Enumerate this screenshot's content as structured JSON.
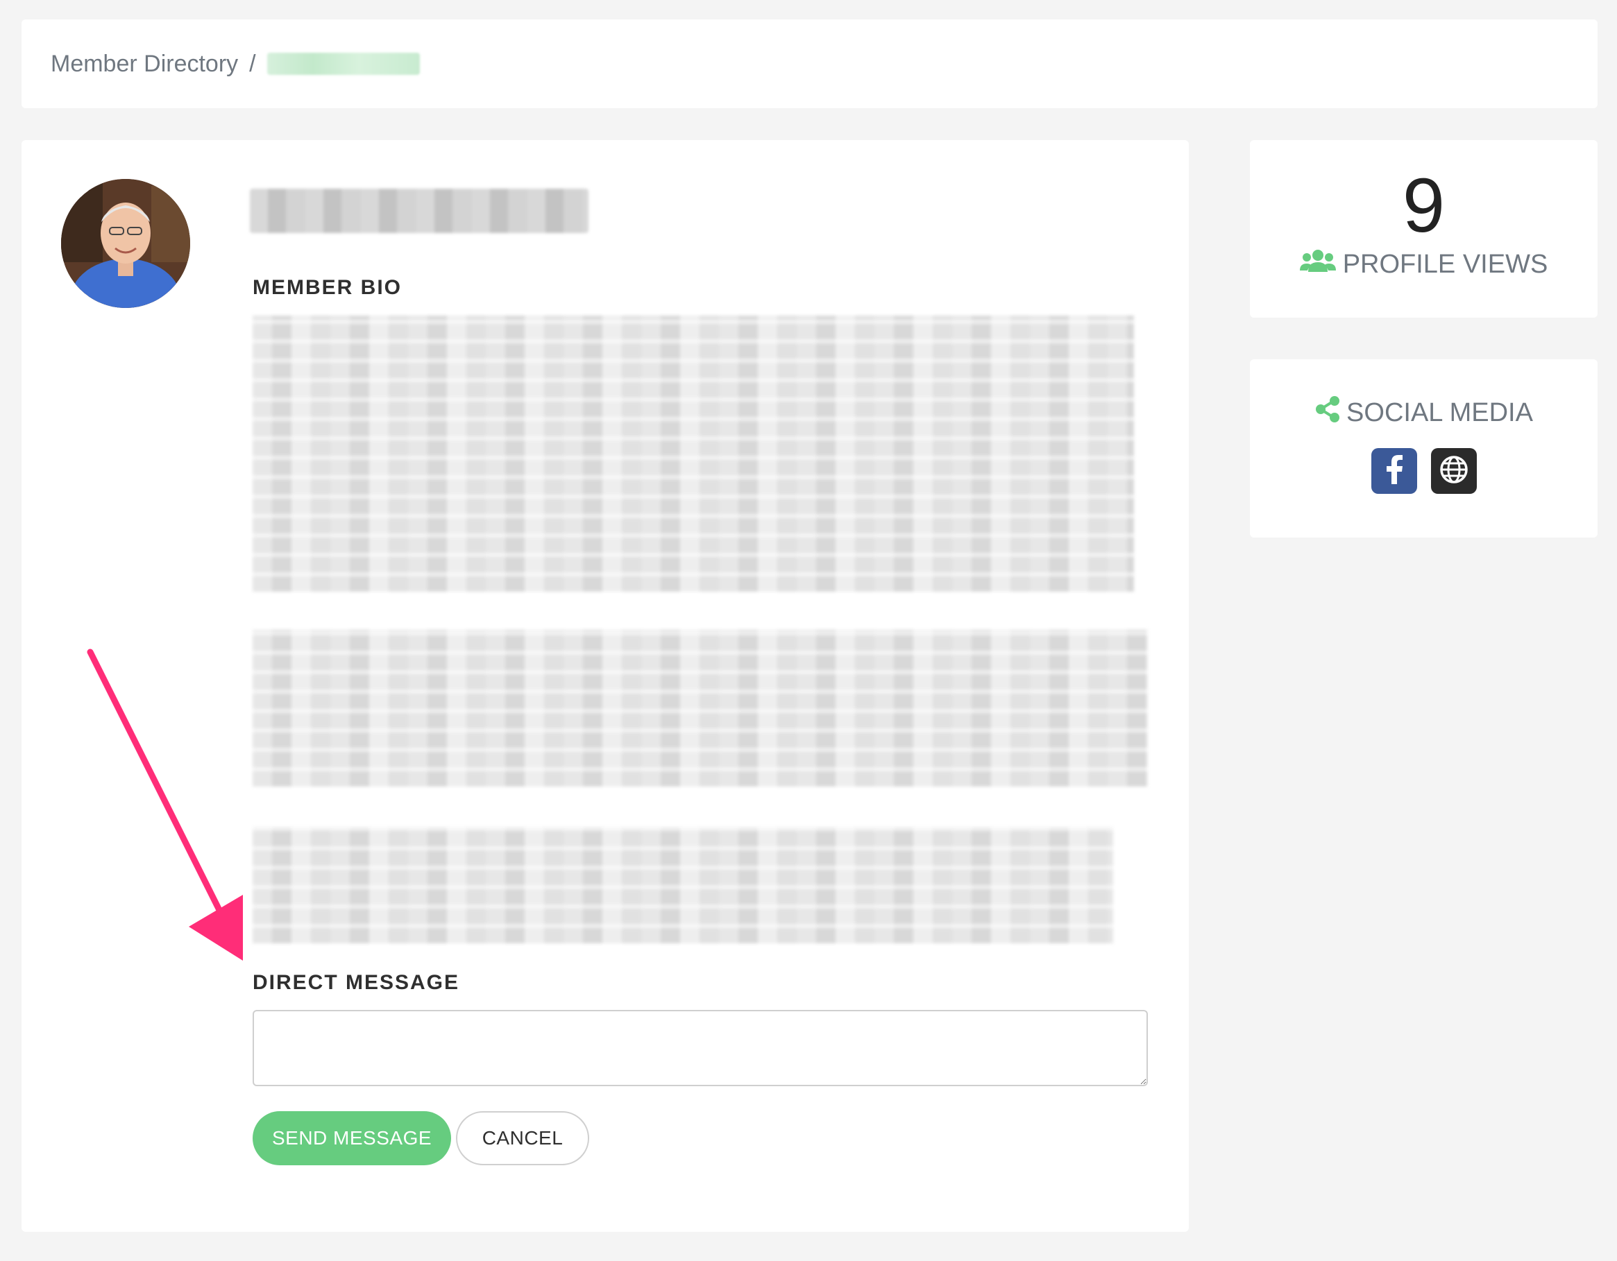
{
  "breadcrumb": {
    "root_label": "Member Directory",
    "separator": "/"
  },
  "profile": {
    "bio_heading": "MEMBER BIO",
    "direct_message_heading": "DIRECT MESSAGE",
    "message_value": "",
    "send_label": "SEND MESSAGE",
    "cancel_label": "CANCEL"
  },
  "stats": {
    "profile_views": "9",
    "profile_views_label": "PROFILE VIEWS",
    "icon": "users-icon"
  },
  "social": {
    "title": "SOCIAL MEDIA",
    "icon": "share-icon",
    "links": [
      {
        "icon": "facebook-icon"
      },
      {
        "icon": "globe-icon"
      }
    ]
  },
  "colors": {
    "accent_green": "#66cc7f",
    "facebook_blue": "#3b5998",
    "annotation_pink": "#ff2d78"
  }
}
